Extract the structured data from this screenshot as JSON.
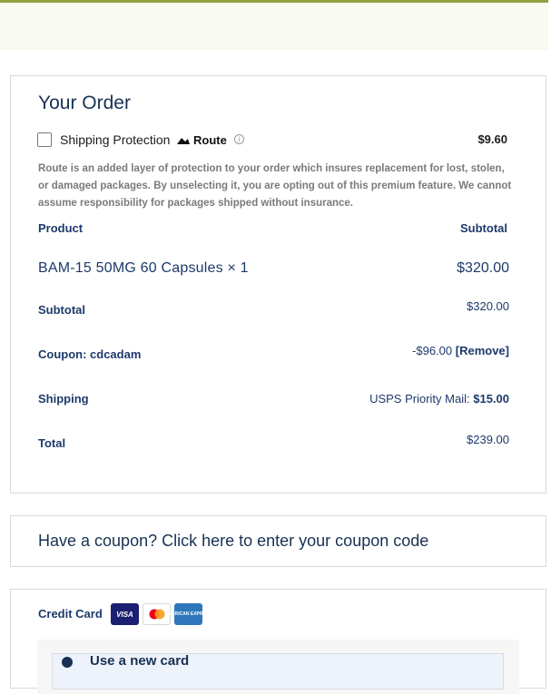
{
  "order": {
    "title": "Your Order",
    "shipping_protection": {
      "label": "Shipping Protection",
      "brand": "Route",
      "price": "$9.60",
      "description": "Route is an added layer of protection to your order which insures replacement for lost, stolen, or damaged packages. By unselecting it, you are opting out of this premium feature. We cannot assume responsibility for packages shipped without insurance.",
      "checked": false
    },
    "columns": {
      "product": "Product",
      "subtotal": "Subtotal"
    },
    "item": {
      "name": "BAM-15 50MG 60 Capsules",
      "qty": "× 1",
      "price": "$320.00"
    },
    "subtotal": {
      "label": "Subtotal",
      "value": "$320.00"
    },
    "coupon": {
      "label": "Coupon: cdcadam",
      "discount": "-$96.00",
      "remove": "[Remove]"
    },
    "shipping": {
      "label": "Shipping",
      "method": "USPS Priority Mail:",
      "price": "$15.00"
    },
    "total": {
      "label": "Total",
      "value": "$239.00"
    }
  },
  "coupon_prompt": "Have a coupon? Click here to enter your coupon code",
  "payment": {
    "label": "Credit Card",
    "card_brands": [
      "VISA",
      "mastercard",
      "AMERICAN EXPRESS"
    ],
    "new_card_label": "Use a new card"
  },
  "colors": {
    "accent_bar": "#8ea342",
    "text_navy": "#1d3a6b",
    "muted": "#7a7a7a"
  }
}
